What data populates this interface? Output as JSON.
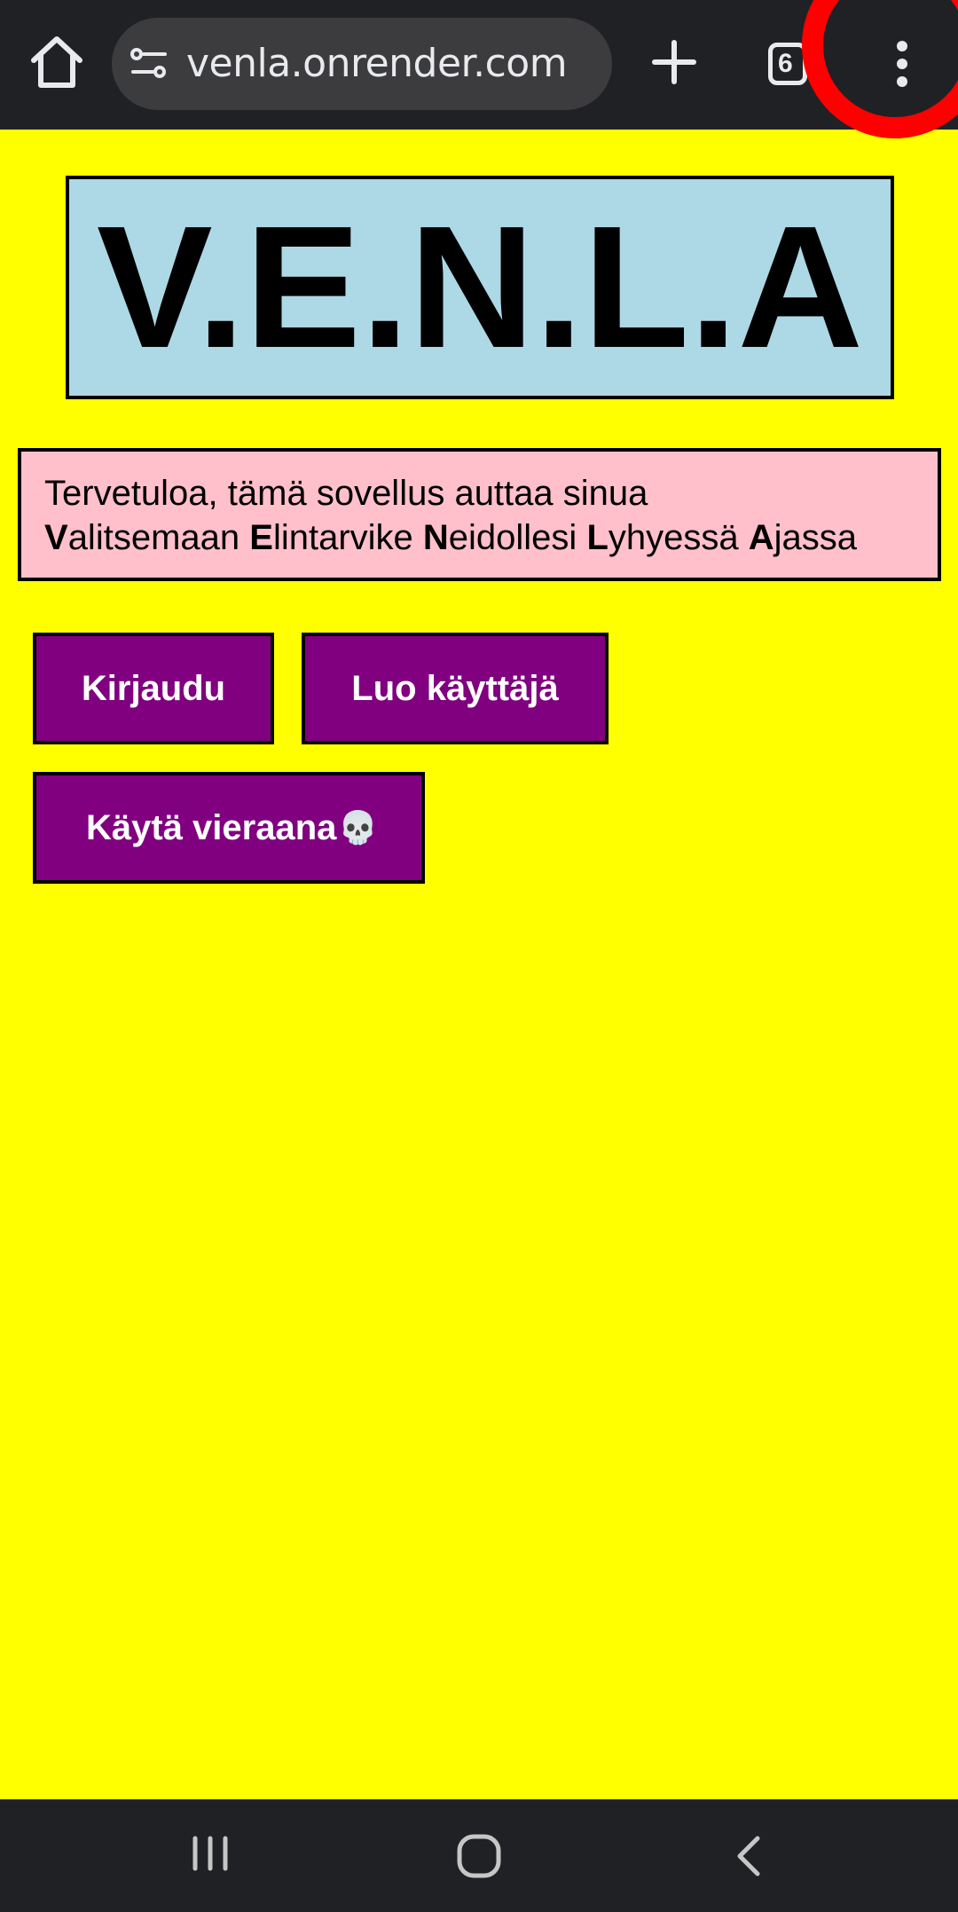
{
  "browser": {
    "url": "venla.onrender.com",
    "tab_count": "6",
    "icons": {
      "home": "home-icon",
      "site_settings": "site-settings-icon",
      "new_tab": "plus-icon",
      "tabs": "tab-switcher-icon",
      "menu": "more-vert-icon"
    },
    "highlight_color": "#ff0000"
  },
  "page": {
    "background": "#ffff00",
    "logo": "V.E.N.L.A",
    "welcome": {
      "line1": "Tervetuloa, tämä sovellus auttaa sinua",
      "parts": [
        {
          "bold": "V",
          "rest": "alitsemaan "
        },
        {
          "bold": "E",
          "rest": "lintarvike "
        },
        {
          "bold": "N",
          "rest": "eidollesi "
        },
        {
          "bold": "L",
          "rest": "yhyessä "
        },
        {
          "bold": "A",
          "rest": "jassa"
        }
      ]
    },
    "buttons": {
      "login": "Kirjaudu",
      "register": "Luo käyttäjä",
      "guest": "Käytä vieraana",
      "guest_emoji": "💀"
    },
    "colors": {
      "logo_bg": "#add8e6",
      "welcome_bg": "#ffc0cb",
      "button_bg": "#800080"
    }
  },
  "android_nav": {
    "recent": "recent-apps-icon",
    "home": "home-circle-icon",
    "back": "back-chevron-icon"
  }
}
